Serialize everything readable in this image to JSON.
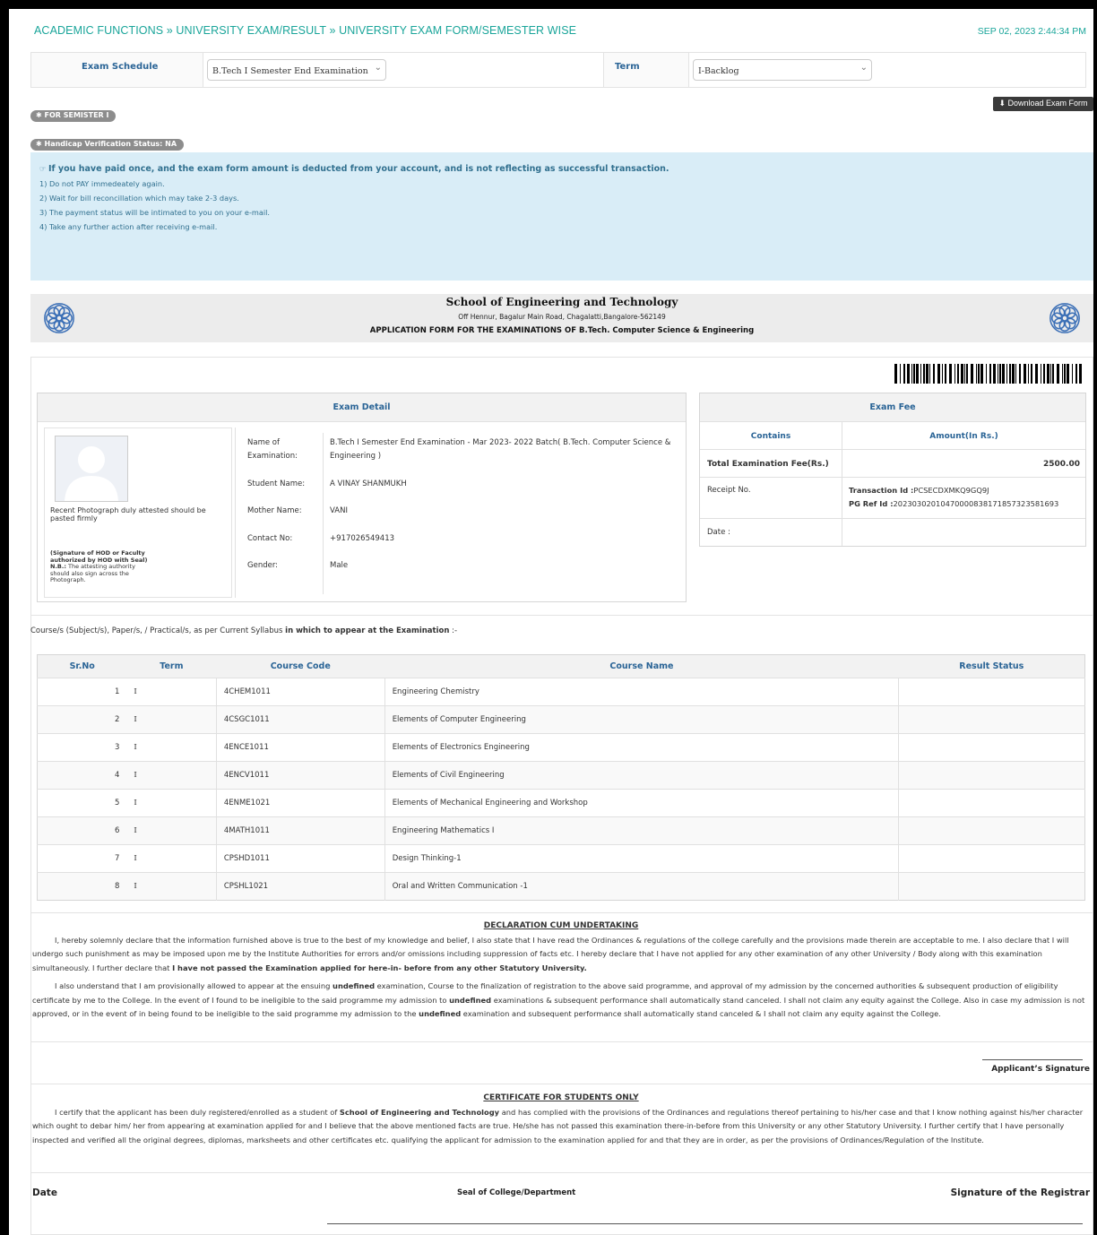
{
  "breadcrumb": "ACADEMIC FUNCTIONS » UNIVERSITY EXAM/RESULT » UNIVERSITY EXAM FORM/SEMESTER WISE",
  "datetime": "SEP 02, 2023  2:44:34 PM",
  "filters": {
    "exam_schedule_label": "Exam Schedule",
    "exam_schedule_value": "B.Tech I Semester End Examination",
    "term_label": "Term",
    "term_value": "I-Backlog"
  },
  "download_button": "Download Exam Form",
  "badges": {
    "semester": "FOR SEMISTER I",
    "handicap": "Handicap Verification Status: NA"
  },
  "notice": {
    "lead": "If you have paid once, and the exam form amount is deducted from your account, and is not reflecting as successful transaction.",
    "items": [
      "1) Do not PAY immedeately again.",
      "2) Wait for bill reconcillation which may take 2-3 days.",
      "3) The payment status will be intimated to you on your e-mail.",
      "4) Take any further action after receiving e-mail."
    ]
  },
  "institute": {
    "name": "School of Engineering and Technology",
    "address": "Off Hennur, Bagalur Main Road, Chagalatti,Bangalore-562149",
    "form_title": "APPLICATION FORM FOR THE EXAMINATIONS OF B.Tech. Computer Science & Engineering"
  },
  "exam_detail": {
    "title": "Exam Detail",
    "photo_note": "Recent Photograph duly attested should be pasted firmly",
    "signature_note": "(Signature of HOD or Faculty authorized by HOD with Seal)",
    "nb_label": "N.B.:",
    "nb_text": "The attesting authority should also sign across the Photograph.",
    "fields": {
      "exam_name_label": "Name of Examination:",
      "exam_name_value": "B.Tech I Semester End Examination - Mar 2023- 2022 Batch( B.Tech. Computer Science & Engineering )",
      "student_name_label": "Student Name:",
      "student_name_value": "A VINAY SHANMUKH",
      "mother_name_label": "Mother Name:",
      "mother_name_value": "VANI",
      "contact_label": "Contact No:",
      "contact_value": "+917026549413",
      "gender_label": "Gender:",
      "gender_value": "Male"
    }
  },
  "exam_fee": {
    "title": "Exam Fee",
    "col_contains": "Contains",
    "col_amount": "Amount(In Rs.)",
    "total_label": "Total Examination Fee(Rs.)",
    "total_value": "2500.00",
    "receipt_label": "Receipt No.",
    "transaction_label": "Transaction Id :",
    "transaction_value": "PCSECDXMKQ9GQ9J",
    "pgref_label": "PG Ref Id :",
    "pgref_value": "2023030201047000083817185732358169​3",
    "date_label": "Date :"
  },
  "courses_intro_a": "Course/s (Subject/s), Paper/s, / Practical/s, as per Current Syllabus ",
  "courses_intro_b": "in which to appear at the Examination",
  "courses_intro_c": " :-",
  "course_table": {
    "headers": [
      "Sr.No",
      "Term",
      "Course Code",
      "Course Name",
      "Result Status"
    ],
    "rows": [
      [
        "1",
        "I",
        "4CHEM1011",
        "Engineering Chemistry",
        ""
      ],
      [
        "2",
        "I",
        "4CSGC1011",
        "Elements of Computer Engineering",
        ""
      ],
      [
        "3",
        "I",
        "4ENCE1011",
        "Elements of Electronics Engineering",
        ""
      ],
      [
        "4",
        "I",
        "4ENCV1011",
        "Elements of Civil Engineering",
        ""
      ],
      [
        "5",
        "I",
        "4ENME1021",
        "Elements of Mechanical Engineering and Workshop",
        ""
      ],
      [
        "6",
        "I",
        "4MATH1011",
        "Engineering Mathematics I",
        ""
      ],
      [
        "7",
        "I",
        "CPSHD1011",
        "Design Thinking-1",
        ""
      ],
      [
        "8",
        "I",
        "CPSHL1021",
        "Oral and Written Communication -1",
        ""
      ]
    ]
  },
  "declaration": {
    "title": "DECLARATION CUM UNDERTAKING",
    "p1_a": "I, hereby solemnly declare that the information furnished above is true to the best of my knowledge and belief, I also state that I have read the Ordinances & regulations of the college carefully and the provisions made therein are acceptable to me. I also declare that I will undergo such punishment as may be imposed upon me by the Institute Authorities for errors and/or omissions including suppression of facts etc. I hereby declare that I have not applied for any other examination of any other University / Body along with this examination simultaneously. I further declare that ",
    "p1_b": "I have not passed the Examination applied for here-in- before from any other Statutory University.",
    "p2_a": "I also understand that I am provisionally allowed to appear at the ensuing ",
    "undef": "undefined",
    "p2_b": " examination, Course to the finalization of registration to the above said programme, and approval of my admission by the concerned authorities & subsequent production of eligibility certificate by me to the College. In the event of I found to be ineligible to the said programme my admission to ",
    "p2_c": " examinations & subsequent performance shall automatically stand canceled. I shall not claim any equity against the College. Also in case my admission is not approved, or in the event of in being found to be ineligible to the said programme my admission to the ",
    "p2_d": " examination and subsequent performance shall automatically stand canceled & I shall not claim any equity against the College."
  },
  "applicant_signature": "Applicant’s Signature",
  "certificate": {
    "title": "CERTIFICATE FOR STUDENTS ONLY",
    "p_a": "I certify that the applicant has been duly registered/enrolled as a student of ",
    "p_b": "School of Engineering and Technology",
    "p_c": " and has complied with the provisions of the Ordinances and regulations thereof pertaining to his/her case and that I know nothing against his/her character which ought to debar him/ her from appearing at examination applied for and I believe that the above mentioned facts are true. He/she has not passed this examination there-in-before from this University or any other Statutory University. I further certify that I have personally inspected and verified all the original degrees, diplomas, marksheets and other certificates etc. qualifying the applicant for admission to the examination applied for and that they are in order, as per the provisions of Ordinances/Regulation of the Institute."
  },
  "footer": {
    "date": "Date",
    "seal": "Seal of College/Department",
    "registrar": "Signature of the Registrar"
  }
}
